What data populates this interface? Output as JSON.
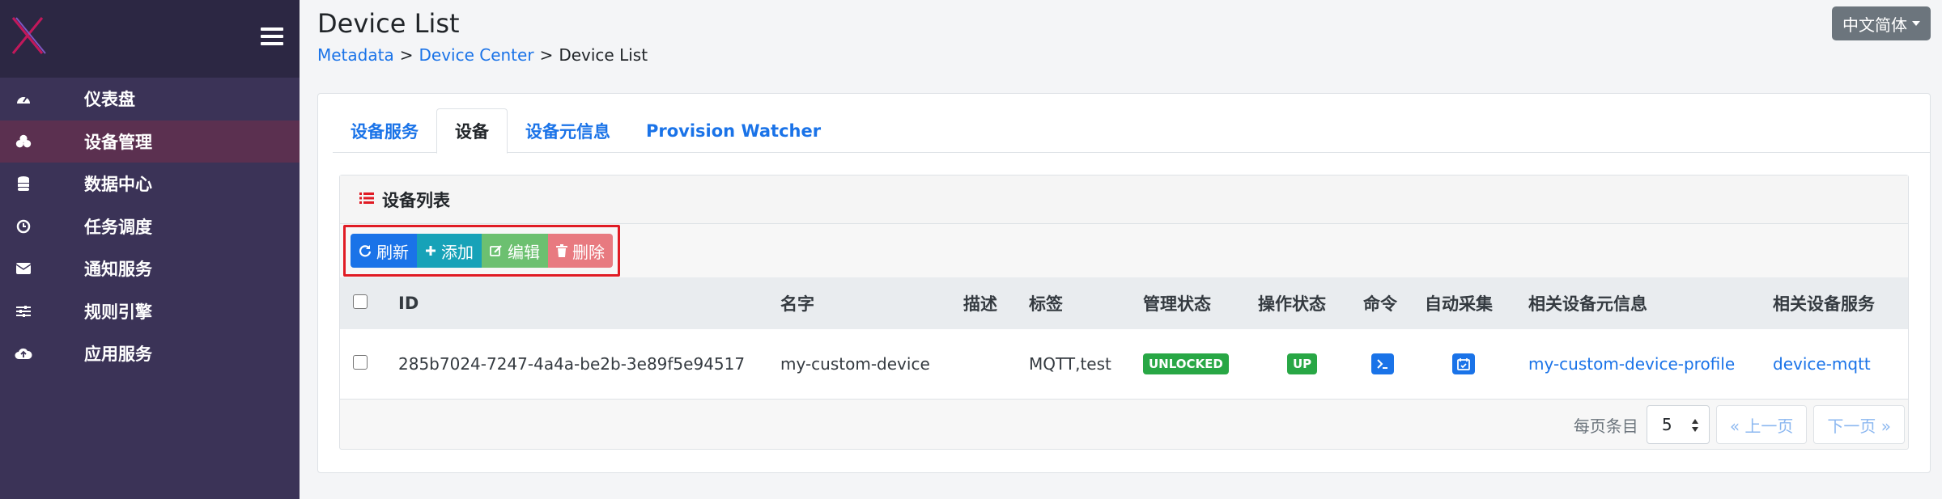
{
  "header": {
    "title": "Device List",
    "breadcrumb": [
      "Metadata",
      "Device Center",
      "Device List"
    ],
    "breadcrumb_sep": ">",
    "language": "中文简体"
  },
  "sidebar": {
    "items": [
      {
        "label": "仪表盘",
        "icon": "dashboard-icon"
      },
      {
        "label": "设备管理",
        "icon": "devices-icon",
        "active": true
      },
      {
        "label": "数据中心",
        "icon": "database-icon"
      },
      {
        "label": "任务调度",
        "icon": "clock-icon"
      },
      {
        "label": "通知服务",
        "icon": "envelope-icon"
      },
      {
        "label": "规则引擎",
        "icon": "sliders-icon"
      },
      {
        "label": "应用服务",
        "icon": "cloud-upload-icon"
      }
    ]
  },
  "tabs": [
    "设备服务",
    "设备",
    "设备元信息",
    "Provision Watcher"
  ],
  "panel": {
    "title": "设备列表",
    "toolbar": {
      "refresh": "刷新",
      "add": "添加",
      "edit": "编辑",
      "delete": "删除"
    }
  },
  "table": {
    "columns": [
      "ID",
      "名字",
      "描述",
      "标签",
      "管理状态",
      "操作状态",
      "命令",
      "自动采集",
      "相关设备元信息",
      "相关设备服务"
    ],
    "rows": [
      {
        "id": "285b7024-7247-4a4a-be2b-3e89f5e94517",
        "name": "my-custom-device",
        "description": "",
        "labels": "MQTT,test",
        "admin_state": "UNLOCKED",
        "op_state": "UP",
        "profile": "my-custom-device-profile",
        "service": "device-mqtt"
      }
    ]
  },
  "pagination": {
    "label": "每页条目",
    "page_size": "5",
    "prev": "« 上一页",
    "next": "下一页 »"
  },
  "colors": {
    "sidebar": "#3b3357",
    "accent": "#1a73e8",
    "success": "#28a745",
    "highlight": "#e01b24"
  }
}
